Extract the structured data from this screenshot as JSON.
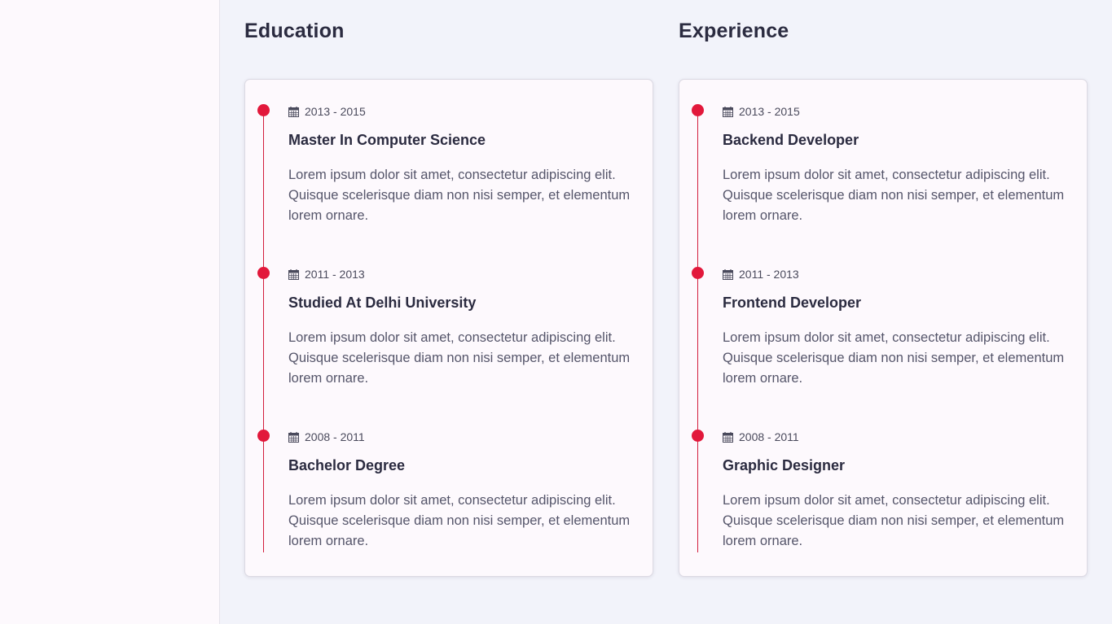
{
  "education": {
    "title": "Education",
    "items": [
      {
        "date": "2013 - 2015",
        "title": "Master In Computer Science",
        "description": "Lorem ipsum dolor sit amet, consectetur adipiscing elit. Quisque scelerisque diam non nisi semper, et elementum lorem ornare."
      },
      {
        "date": "2011 - 2013",
        "title": "Studied At Delhi University",
        "description": "Lorem ipsum dolor sit amet, consectetur adipiscing elit. Quisque scelerisque diam non nisi semper, et elementum lorem ornare."
      },
      {
        "date": "2008 - 2011",
        "title": "Bachelor Degree",
        "description": "Lorem ipsum dolor sit amet, consectetur adipiscing elit. Quisque scelerisque diam non nisi semper, et elementum lorem ornare."
      }
    ]
  },
  "experience": {
    "title": "Experience",
    "items": [
      {
        "date": "2013 - 2015",
        "title": "Backend Developer",
        "description": "Lorem ipsum dolor sit amet, consectetur adipiscing elit. Quisque scelerisque diam non nisi semper, et elementum lorem ornare."
      },
      {
        "date": "2011 - 2013",
        "title": "Frontend Developer",
        "description": "Lorem ipsum dolor sit amet, consectetur adipiscing elit. Quisque scelerisque diam non nisi semper, et elementum lorem ornare."
      },
      {
        "date": "2008 - 2011",
        "title": "Graphic Designer",
        "description": "Lorem ipsum dolor sit amet, consectetur adipiscing elit. Quisque scelerisque diam non nisi semper, et elementum lorem ornare."
      }
    ]
  },
  "icons": {
    "date": "calendar-icon"
  },
  "colors": {
    "accent": "#e2183b",
    "heading": "#2b2b40",
    "background": "#f2f3fa",
    "card": "#fdf9fd"
  }
}
